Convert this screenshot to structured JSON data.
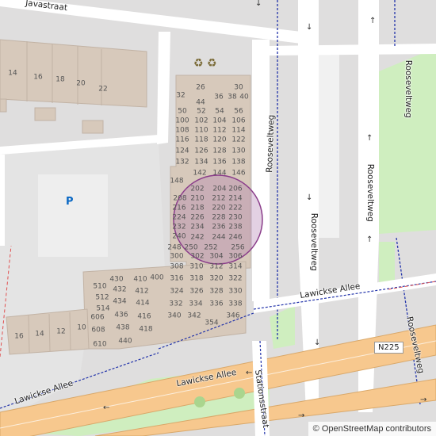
{
  "map": {
    "streets": {
      "javastraat": "Javastraat",
      "rooseveltweg_1": "Rooseveltweg",
      "rooseveltweg_2": "Rooseveltweg",
      "rooseveltweg_3": "Rooseveltweg",
      "rooseveltweg_4": "Rooseveltweg",
      "lawickse_allee_1": "Lawickse Allee",
      "lawickse_allee_2": "Lawickse Allee",
      "lawickse_allee_3": "Lawickse Allee",
      "stationsstraat": "Stationsstraat"
    },
    "route_shield": "N225",
    "parking_symbol": "P",
    "recycling_symbol": "♻ ♻",
    "house_numbers_top_row": [
      "14",
      "16",
      "18",
      "20",
      "22"
    ],
    "house_numbers_bottom_row": [
      "16",
      "14",
      "12",
      "10"
    ],
    "house_numbers_block": [
      "26",
      "30",
      "32",
      "36",
      "38",
      "40",
      "44",
      "50",
      "52",
      "54",
      "56",
      "100",
      "102",
      "104",
      "106",
      "108",
      "110",
      "112",
      "114",
      "116",
      "118",
      "120",
      "122",
      "124",
      "126",
      "128",
      "130",
      "132",
      "134",
      "136",
      "138",
      "142",
      "144",
      "146",
      "148",
      "202",
      "204",
      "206",
      "208",
      "210",
      "212",
      "214",
      "216",
      "218",
      "220",
      "222",
      "224",
      "226",
      "228",
      "230",
      "232",
      "234",
      "236",
      "238",
      "240",
      "242",
      "244",
      "246",
      "248",
      "250",
      "252",
      "256",
      "300",
      "302",
      "304",
      "306",
      "308",
      "310",
      "312",
      "314",
      "316",
      "318",
      "320",
      "322",
      "324",
      "326",
      "328",
      "330",
      "332",
      "334",
      "336",
      "338",
      "340",
      "342",
      "346",
      "354",
      "400",
      "410",
      "412",
      "414",
      "416",
      "418",
      "430",
      "432",
      "434",
      "436",
      "438",
      "440",
      "510",
      "512",
      "514",
      "606",
      "608",
      "610"
    ],
    "attribution": "© OpenStreetMap contributors",
    "colors": {
      "background": "#dfdede",
      "building": "#d5c9bd",
      "road": "#ffffff",
      "primary_road": "#f7c68c",
      "grass": "#c8e8b0",
      "highlight_fill": "#b07ab0",
      "route_line": "#2233aa"
    },
    "icons": {
      "parking": "parking-icon",
      "recycling": "recycling-icon"
    }
  }
}
